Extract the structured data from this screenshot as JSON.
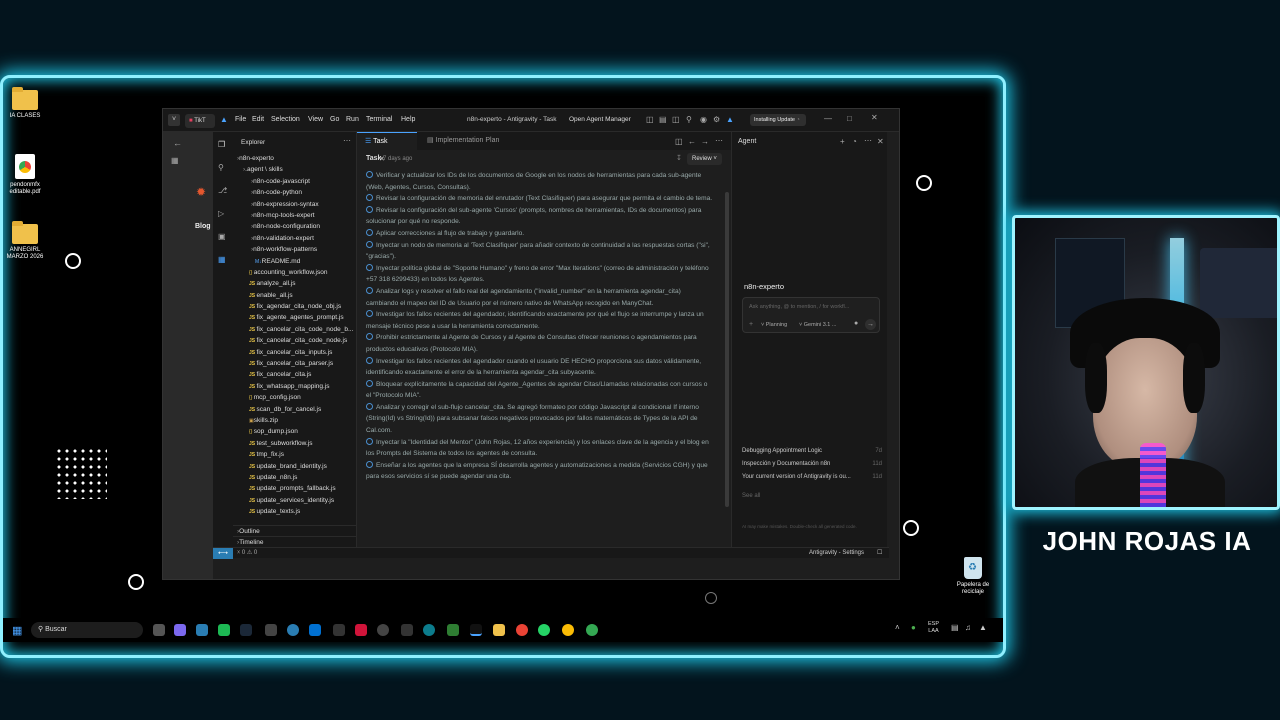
{
  "desktop": {
    "icons": [
      {
        "label": "IA CLASES",
        "icon": "folder-icon"
      },
      {
        "label": "pendonmfx editable.pdf",
        "icon": "pdf-icon"
      },
      {
        "label": "ANNEGIRL MARZO 2026",
        "icon": "folder-icon"
      }
    ],
    "recycle_label": "Papelera de reciclaje"
  },
  "window": {
    "title": "n8n-experto - Antigravity - Task",
    "menu": [
      "File",
      "Edit",
      "Selection",
      "View",
      "Go",
      "Run",
      "Terminal",
      "Help"
    ],
    "open_agent_manager": "Open Agent Manager",
    "update_badge": "Installing Update",
    "browser": {
      "tab_label": "TikT",
      "blog": "Blog"
    },
    "explorer": {
      "title": "Explorer",
      "root": "n8n-experto",
      "agent_folder": ".agent \\ skills",
      "folders": [
        "n8n-code-javascript",
        "n8n-code-python",
        "n8n-expression-syntax",
        "n8n-mcp-tools-expert",
        "n8n-node-configuration",
        "n8n-validation-expert",
        "n8n-workflow-patterns"
      ],
      "files": [
        {
          "name": "README.md",
          "type": "md"
        },
        {
          "name": "accounting_workflow.json",
          "type": "json"
        },
        {
          "name": "analyze_all.js",
          "type": "js"
        },
        {
          "name": "enable_all.js",
          "type": "js"
        },
        {
          "name": "fix_agendar_cita_node_obj.js",
          "type": "js"
        },
        {
          "name": "fix_agente_agentes_prompt.js",
          "type": "js"
        },
        {
          "name": "fix_cancelar_cita_code_node_b...",
          "type": "js"
        },
        {
          "name": "fix_cancelar_cita_code_node.js",
          "type": "js"
        },
        {
          "name": "fix_cancelar_cita_inputs.js",
          "type": "js"
        },
        {
          "name": "fix_cancelar_cita_parser.js",
          "type": "js"
        },
        {
          "name": "fix_cancelar_cita.js",
          "type": "js"
        },
        {
          "name": "fix_whatsapp_mapping.js",
          "type": "js"
        },
        {
          "name": "mcp_config.json",
          "type": "json"
        },
        {
          "name": "scan_db_for_cancel.js",
          "type": "js"
        },
        {
          "name": "skills.zip",
          "type": "zip"
        },
        {
          "name": "sop_dump.json",
          "type": "json"
        },
        {
          "name": "test_subworkflow.js",
          "type": "js"
        },
        {
          "name": "tmp_fix.js",
          "type": "js"
        },
        {
          "name": "update_brand_identity.js",
          "type": "js"
        },
        {
          "name": "update_n8n.js",
          "type": "js"
        },
        {
          "name": "update_prompts_fallback.js",
          "type": "js"
        },
        {
          "name": "update_services_identity.js",
          "type": "js"
        },
        {
          "name": "update_texts.js",
          "type": "js"
        }
      ],
      "outline": "Outline",
      "timeline": "Timeline"
    },
    "editor": {
      "tabs": [
        "Task",
        "Implementation Plan"
      ],
      "header_title": "Task",
      "header_time": "7 days ago",
      "review_button": "Review",
      "items": [
        "Verificar y actualizar los IDs de los documentos de Google en los nodos de herramientas para cada sub-agente (Web, Agentes, Cursos, Consultas).",
        "Revisar la configuración de memoria del enrutador (Text Clasifiquer) para asegurar que permita el cambio de tema.",
        "Revisar la configuración del sub-agente 'Cursos' (prompts, nombres de herramientas, IDs de documentos) para solucionar por qué no responde.",
        "Aplicar correcciones al flujo de trabajo y guardarlo.",
        "Inyectar un nodo de memoria al 'Text Clasifiquer' para añadir contexto de continuidad a las respuestas cortas (\"si\", \"gracias\").",
        "Inyectar política global de \"Soporte Humano\" y freno de error \"Max Iterations\" (correo de administración y teléfono +57 318 6299433) en todos los Agentes.",
        "Analizar logs y resolver el fallo real del agendamiento (\"invalid_number\" en la herramienta agendar_cita) cambiando el mapeo del ID de Usuario por el número nativo de WhatsApp recogido en ManyChat.",
        "Investigar los fallos recientes del agendador, identificando exactamente por qué el flujo se interrumpe y lanza un mensaje técnico pese a usar la herramienta correctamente.",
        "Prohibir estrictamente al Agente de Cursos y al Agente de Consultas ofrecer reuniones o agendamientos para productos educativos (Protocolo MIA).",
        "Investigar los fallos recientes del agendador cuando el usuario DE HECHO proporciona sus datos válidamente, identificando exactamente el error de la herramienta agendar_cita subyacente.",
        "Bloquear explícitamente la capacidad del Agente_Agentes de agendar Citas/Llamadas relacionadas con cursos o el \"Protocolo MIA\".",
        "Analizar y corregir el sub-flujo cancelar_cita. Se agregó formateo por código Javascript al condicional If interno (String(Id) vs String(Id)) para subsanar falsos negativos provocados por fallos matemáticos de Types de la API de Cal.com.",
        "Inyectar la \"Identidad del Mentor\" (John Rojas, 12 años experiencia) y los enlaces clave de la agencia y el blog en los Prompts del Sistema de todos los agentes de consulta.",
        "Enseñar a los agentes que la empresa SÍ desarrolla agentes y automatizaciones a medida (Servicios CGH) y que para esos servicios sí se puede agendar una cita."
      ]
    },
    "agent": {
      "title": "Agent",
      "workspace": "n8n-experto",
      "input_placeholder": "Ask anything, @ to mention, / for workfl...",
      "mode": "Planning",
      "model": "Gemini 3.1 ...",
      "history": [
        {
          "title": "Debugging Appointment Logic",
          "age": "7d"
        },
        {
          "title": "Inspección y Documentación n8n",
          "age": "11d"
        },
        {
          "title": "Your current version of Antigravity is ou...",
          "age": "11d"
        }
      ],
      "see_all": "See all",
      "disclaimer": "AI may make mistakes. Double-check all generated code."
    },
    "status": {
      "problems": "0 ⚠ 0",
      "right": "Antigravity - Settings"
    }
  },
  "taskbar": {
    "search": "Buscar",
    "lang": "ESP",
    "lang2": "LAA"
  },
  "overlay": {
    "name": "JOHN ROJAS IA"
  }
}
